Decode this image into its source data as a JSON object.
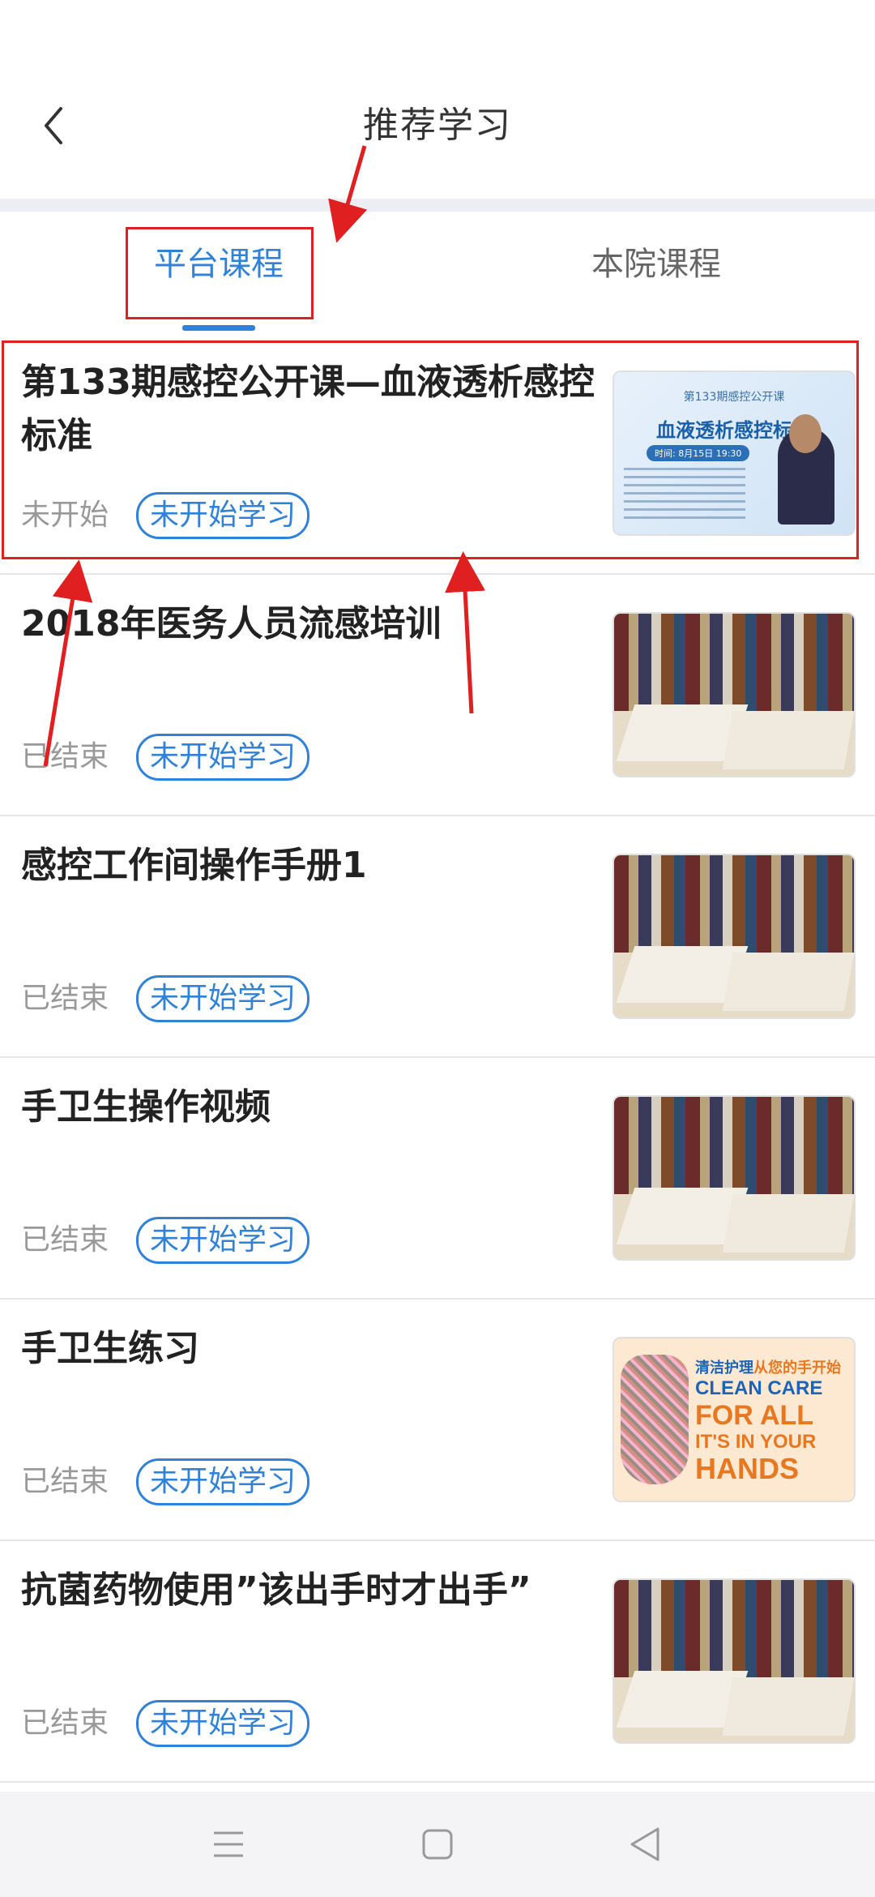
{
  "header": {
    "title": "推荐学习",
    "back_icon": "chevron-left-icon"
  },
  "tabs": [
    {
      "label": "平台课程",
      "active": true
    },
    {
      "label": "本院课程",
      "active": false
    }
  ],
  "courses": [
    {
      "title": "第133期感控公开课—血液透析感控标准",
      "status": "未开始",
      "badge": "未开始学习",
      "thumb": "poster",
      "poster": {
        "banner": "第133期感控公开课",
        "title": "血液透析感控标准",
        "time": "时间: 8月15日 19:30"
      }
    },
    {
      "title": "2018年医务人员流感培训",
      "status": "已结束",
      "badge": "未开始学习",
      "thumb": "book"
    },
    {
      "title": "感控工作间操作手册1",
      "status": "已结束",
      "badge": "未开始学习",
      "thumb": "book"
    },
    {
      "title": "手卫生操作视频",
      "status": "已结束",
      "badge": "未开始学习",
      "thumb": "book"
    },
    {
      "title": "手卫生练习",
      "status": "已结束",
      "badge": "未开始学习",
      "thumb": "hands",
      "hands": {
        "zh_a": "清洁护理",
        "zh_b": "从您的手开始",
        "line1": "CLEAN CARE",
        "line2": "FOR ALL",
        "line3": "IT'S IN YOUR",
        "line4": "HANDS"
      }
    },
    {
      "title": "抗菌药物使用”该出手时才出手”",
      "status": "已结束",
      "badge": "未开始学习",
      "thumb": "book"
    }
  ],
  "colors": {
    "accent": "#2f82d8",
    "annotation": "#e02020"
  },
  "navbar": {
    "icons": [
      "menu-icon",
      "home-square-icon",
      "back-triangle-icon"
    ]
  }
}
